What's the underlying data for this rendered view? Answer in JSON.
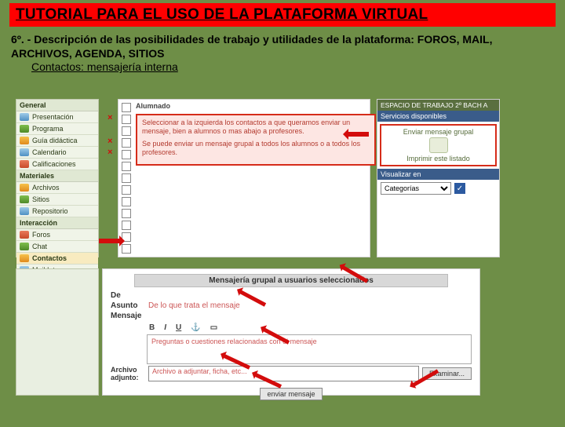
{
  "title": "TUTORIAL PARA EL USO DE LA PLATAFORMA VIRTUAL",
  "section_head": "6º. - Descripción de las posibilidades de trabajo y utilidades de la plataforma: FOROS, MAIL, ARCHIVOS, AGENDA, SITIOS",
  "section_sub": "Contactos: mensajería interna",
  "sidebar": {
    "header": "General",
    "items": [
      "Presentación",
      "Programa",
      "Guía didáctica",
      "Calendario",
      "Calificaciones"
    ],
    "header2": "Materiales",
    "items2": [
      "Archivos",
      "Sitios",
      "Repositorio"
    ],
    "header3": "Interacción",
    "items3": [
      "Foros",
      "Chat",
      "Contactos",
      "Mail Interno"
    ]
  },
  "mid": {
    "alumnado": "Alumnado",
    "line1": "Seleccionar a la izquierda los contactos a que queramos enviar un mensaje, bien a alumnos o mas abajo a profesores.",
    "line2": "Se puede enviar un mensaje grupal a todos los alumnos o a todos los profesores."
  },
  "right": {
    "space": "ESPACIO DE TRABAJO 2º BACH A",
    "serv": "Servicios disponibles",
    "msg": "Enviar mensaje grupal",
    "print": "Imprimir este listado",
    "visual": "Visualizar en",
    "sel": "Categorías"
  },
  "compose": {
    "title": "Mensajería grupal a usuarios seleccionados",
    "de": "De",
    "asunto": "Asunto",
    "asunto_ph": "De lo que trata el mensaje",
    "mensaje": "Mensaje",
    "body_ph": "Preguntas o cuestiones relacionadas con el mensaje",
    "adj": "Archivo adjunto:",
    "adj_ph": "Archivo a adjuntar, ficha, etc...",
    "examinar": "Examinar...",
    "enviar": "enviar mensaje"
  }
}
